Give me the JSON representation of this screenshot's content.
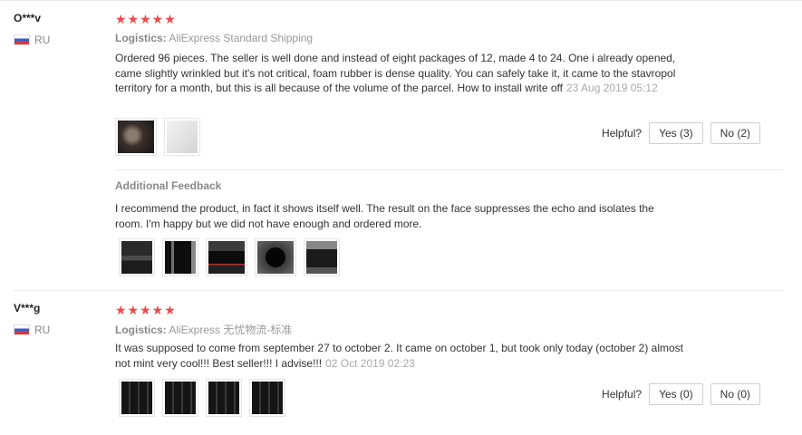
{
  "reviews": [
    {
      "user": "O***v",
      "country": "RU",
      "stars": "★★★★★",
      "logistics_label": "Logistics:",
      "logistics_value": "AliExpress Standard Shipping",
      "text": "Ordered 96 pieces. The seller is well done and instead of eight packages of 12, made 4 to 24. One i already opened, came slightly wrinkled but it's not critical, foam rubber is dense quality. You can safely take it, it came to the stavropol territory for a month, but this is all because of the volume of the parcel. How to install write off",
      "date": "23 Aug 2019 05:12",
      "helpful_label": "Helpful?",
      "yes_label": "Yes (3)",
      "no_label": "No (2)",
      "additional_title": "Additional Feedback",
      "additional_text": "I recommend the product, in fact it shows itself well. The result on the face suppresses the echo and isolates the room. I'm happy but we did not have enough and ordered more."
    },
    {
      "user": "V***g",
      "country": "RU",
      "stars": "★★★★★",
      "logistics_label": "Logistics:",
      "logistics_value": "AliExpress 无忧物流-标准",
      "text": "It was supposed to come from september 27 to october 2. It came on october 1, but took only today (october 2) almost not mint very cool!!! Best seller!!! I advise!!!",
      "date": "02 Oct 2019 02:23",
      "helpful_label": "Helpful?",
      "yes_label": "Yes (0)",
      "no_label": "No (0)"
    }
  ],
  "colors": {
    "star": "#f04848",
    "muted_text": "#999999",
    "border": "#cfcfcf"
  }
}
